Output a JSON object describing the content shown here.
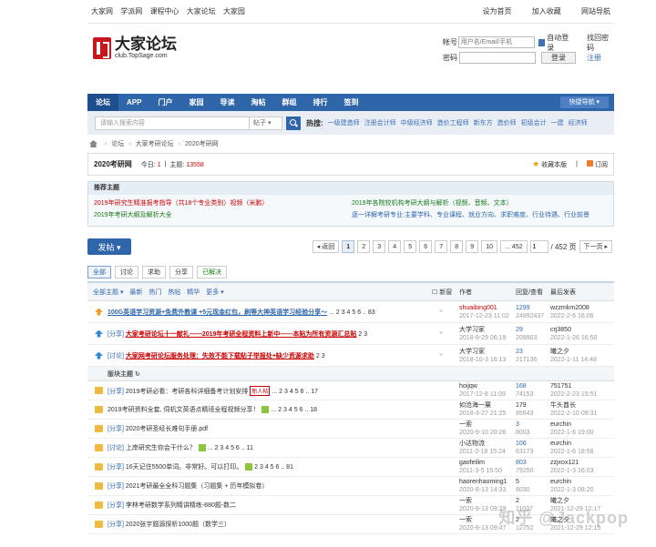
{
  "top": {
    "left": [
      "大家网",
      "学派网",
      "课程中心",
      "大家论坛",
      "大家园"
    ],
    "right": [
      "设为首页",
      "加入收藏",
      "网站导航"
    ]
  },
  "header": {
    "logo_title": "大家论坛",
    "logo_domain": "club.TopSage.com"
  },
  "login": {
    "account_label": "帐号",
    "account_placeholder": "用户名/Email/手机",
    "auto_label": "自动登录",
    "forgot": "找回密码",
    "password_label": "密码",
    "login_btn": "登录",
    "register": "注册"
  },
  "nav": {
    "items": [
      "论坛",
      "APP",
      "门户",
      "家园",
      "导读",
      "淘帖",
      "群组",
      "排行",
      "签到"
    ],
    "quick": "快捷导航 ▾"
  },
  "search": {
    "placeholder": "请输入搜索内容",
    "scope": "帖子 ▾",
    "hot_label": "热搜:",
    "hot": [
      "一级建造师",
      "注册会计师",
      "中级经济师",
      "造价工程师",
      "新东方",
      "造价师",
      "初级会计",
      "一建",
      "经济师"
    ]
  },
  "crumb": {
    "sep": "›",
    "items": [
      "论坛",
      "大家考研论坛",
      "2020考研网"
    ]
  },
  "forum": {
    "title": "2020考研网",
    "today_label": "今日: ",
    "today": "1",
    "sep": "|",
    "topic_label": "主题: ",
    "topics": "13558",
    "favorite": "收藏本版",
    "subscribe": "订阅"
  },
  "rec": {
    "title": "推荐主题",
    "links": [
      "2019年研究生精准报考指导（共18个专业类别）视频（米鹏）",
      "2019年各院校机构考研大纲与解析（视频、音频、文本）",
      "2019年考研大纲及解析大全",
      "逐一详解考研专业:主要学科、专业课程、就业方向、求职难度、行业待遇、行业前景"
    ]
  },
  "pager": {
    "post": "发帖 ▾",
    "back": "◂ 返回",
    "pages": [
      "1",
      "2",
      "3",
      "4",
      "5",
      "6",
      "7",
      "8",
      "9",
      "10"
    ],
    "last": "... 452",
    "current": "1",
    "total": "/ 452 页",
    "next": "下一页 ▸"
  },
  "filters": [
    "全部",
    "讨论",
    "求助",
    "分享",
    "已解决"
  ],
  "thead": {
    "sort": [
      "全部主题 ▾",
      "最新",
      "热门",
      "热帖",
      "精华",
      "更多 ▾"
    ],
    "newwin": "☐ 新窗",
    "author": "作者",
    "replies": "回复/查看",
    "last": "最后发表"
  },
  "section": "版块主题 ↻",
  "rows": [
    {
      "tag": "",
      "title": "100G英语学习资源+免费外教课 +5元现金红包，刷等大神英语学习经验分享～",
      "pages": "... 2 3 4 5 6 .. 83",
      "author": "shuaibing001",
      "date": "2017-12-23 11:02",
      "replies": "1299",
      "views": "24992437",
      "last_user": "wzzmkm2008",
      "last_date": "2022-2-6 16:06"
    },
    {
      "tag": "[分享]",
      "title": "大家考研论坛十一献礼——2019年考研全程资料上新中——本贴为所有资源汇总贴",
      "pages": "2 3",
      "author": "大学习家",
      "date": "2018-9-29 06:19",
      "replies": "29",
      "views": "209903",
      "last_user": "crj3850",
      "last_date": "2022-1-26 16:50"
    },
    {
      "tag": "[讨论]",
      "title": "大家网考研论坛服务处理：失效不能下载贴子举报处+缺少资源求助",
      "pages": "2 3",
      "author": "大学习家",
      "date": "2018-10-3 16:13",
      "replies": "23",
      "views": "217136",
      "last_user": "曦之夕",
      "last_date": "2022-1-11 14:48"
    },
    {
      "tag": "[分享]",
      "title": "2019考研必看：考研各科详细备考计划安排",
      "badge": "新人帖",
      "pages": "... 2 3 4 5 6 .. 17",
      "author": "hoijqw",
      "date": "2017-12-8 11:09",
      "replies": "168",
      "views": "74153",
      "last_user": "751751",
      "last_date": "2022-2-23 15:51"
    },
    {
      "tag": "",
      "title": "2019考研资料全套, 伺机文英语点睛班全程视频分享！",
      "pages": "... 2 3 4 5 6 .. 18",
      "author": "如沧海一粟",
      "date": "2018-3-27 21:25",
      "replies": "179",
      "views": "85543",
      "last_user": "牛头酋长",
      "last_date": "2022-2-10 09:31"
    },
    {
      "tag": "[分享]",
      "title": "2020考研圣经长难句手册.pdf",
      "author": "一索",
      "date": "2020-9-10 20:26",
      "replies": "3",
      "views": "8003",
      "last_user": "eurchin",
      "last_date": "2022-1-6 19:00"
    },
    {
      "tag": "[讨论]",
      "title": "上岸研究生你会干什么？",
      "pages": "... 2 3 4 5 6 .. 11",
      "author": "小达物流",
      "date": "2011-2-18 15:24",
      "replies": "106",
      "views": "63173",
      "last_user": "eurchin",
      "last_date": "2022-1-6 18:58"
    },
    {
      "tag": "[分享]",
      "title": "16天记住5500单词。非常好。可以打印。",
      "pages": "2 3 4 5 6 .. 81",
      "author": "gaofeilim",
      "date": "2011-3-5 15:50",
      "replies": "803",
      "views": "79250",
      "last_user": "zzjxox121",
      "last_date": "2022-1-3 16:03"
    },
    {
      "tag": "[分享]",
      "title": "2021考研最全全科习题集（习题集 + 历年模拟卷）",
      "author": "haorenhaoming1",
      "date": "2020-8-13 14:33",
      "replies": "5",
      "views": "8030",
      "last_user": "eurchin",
      "last_date": "2022-1-3 08:20"
    },
    {
      "tag": "[分享]",
      "title": "李林考研数学系列精讲精练-880题-数二",
      "author": "一索",
      "date": "2020-9-13 09:29",
      "replies": "2",
      "views": "11037",
      "last_user": "曦之夕",
      "last_date": "2021-12-29 12:17"
    },
    {
      "tag": "[分享]",
      "title": "2020张宇题源探析1000题（数学三）",
      "author": "一索",
      "date": "2020-9-13 09:47",
      "replies": "2",
      "views": "12752",
      "last_user": "曦之夕",
      "last_date": "2021-12-29 12:15"
    }
  ],
  "watermark": "知乎 @Jackpop",
  "colors": {
    "nav_blue": "#2f66aa",
    "highlight_red": "#c00000",
    "accent_green": "#177a17"
  }
}
